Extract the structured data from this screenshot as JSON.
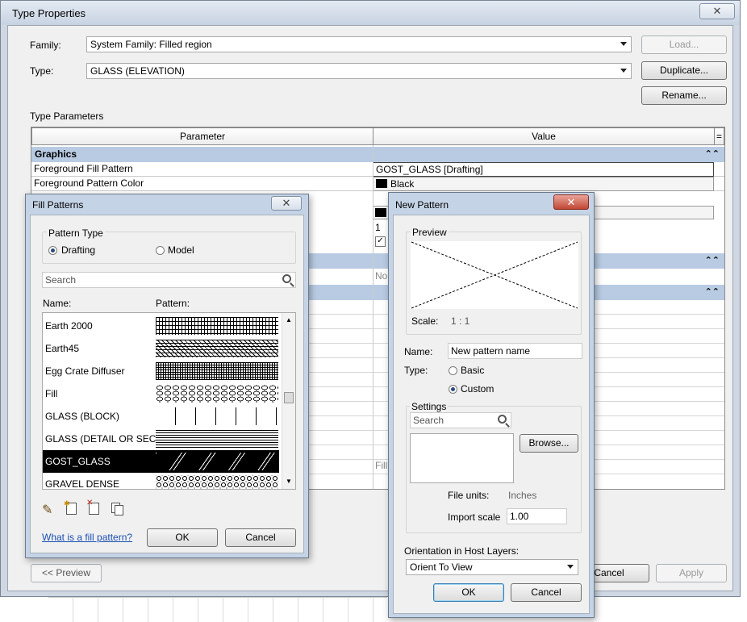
{
  "type_properties": {
    "title": "Type Properties",
    "family_label": "Family:",
    "family_value": "System Family: Filled region",
    "type_label": "Type:",
    "type_value": "GLASS (ELEVATION)",
    "load_button": "Load...",
    "duplicate_button": "Duplicate...",
    "rename_button": "Rename...",
    "type_parameters_label": "Type Parameters",
    "col_parameter": "Parameter",
    "col_value": "Value",
    "col_extra": "=",
    "group_graphics": "Graphics",
    "rows": [
      {
        "param": "Foreground Fill Pattern",
        "value": "GOST_GLASS [Drafting]"
      },
      {
        "param": "Foreground Pattern Color",
        "value": "Black"
      }
    ],
    "partial_value_1": "1",
    "partial_value_none": "No",
    "partial_value_fill": "Fill",
    "preview_button": "<< Preview",
    "cancel_button": "Cancel",
    "apply_button": "Apply"
  },
  "fill_patterns": {
    "title": "Fill Patterns",
    "pattern_type_label": "Pattern Type",
    "drafting_label": "Drafting",
    "model_label": "Model",
    "search_placeholder": "Search",
    "name_header": "Name:",
    "pattern_header": "Pattern:",
    "items": [
      {
        "name": "Earth 2000"
      },
      {
        "name": "Earth45"
      },
      {
        "name": "Egg Crate Diffuser"
      },
      {
        "name": "Fill"
      },
      {
        "name": "GLASS (BLOCK)"
      },
      {
        "name": "GLASS (DETAIL OR SECTI"
      },
      {
        "name": "GOST_GLASS"
      },
      {
        "name": "GRAVEL DENSE"
      }
    ],
    "selected_item": "GOST_GLASS",
    "help_link": "What is a fill pattern?",
    "ok_button": "OK",
    "cancel_button": "Cancel"
  },
  "new_pattern": {
    "title": "New Pattern",
    "preview_label": "Preview",
    "scale_label": "Scale:",
    "scale_value": "1 : 1",
    "name_label": "Name:",
    "name_value": "New pattern name",
    "type_label": "Type:",
    "basic_label": "Basic",
    "custom_label": "Custom",
    "settings_label": "Settings",
    "search_placeholder": "Search",
    "browse_button": "Browse...",
    "file_units_label": "File units:",
    "file_units_value": "Inches",
    "import_scale_label": "Import scale",
    "import_scale_value": "1.00",
    "orientation_label": "Orientation in Host Layers:",
    "orientation_value": "Orient To View",
    "ok_button": "OK",
    "cancel_button": "Cancel"
  },
  "icons": [
    "close-icon",
    "search-icon",
    "edit-pencil-icon",
    "new-pattern-icon",
    "delete-pattern-icon",
    "duplicate-pattern-icon",
    "dropdown-arrow-icon",
    "collapse-icon"
  ],
  "colors": {
    "selection": "#000000",
    "group_header": "#b8cbe3",
    "link": "#1a4fb3",
    "close_red": "#c24634"
  }
}
